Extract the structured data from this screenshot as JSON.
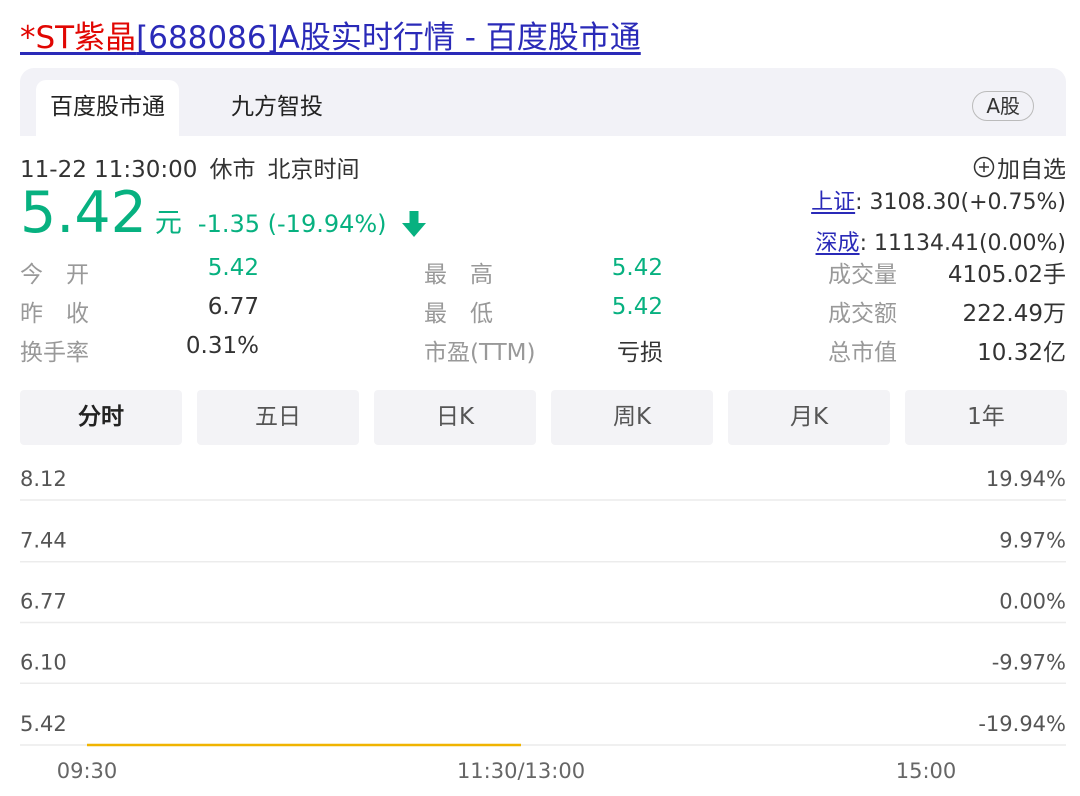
{
  "title": {
    "highlight": "*ST紫晶",
    "rest": "[688086]A股实时行情 - 百度股市通"
  },
  "tabs": [
    "百度股市通",
    "九方智投"
  ],
  "market_badge": "A股",
  "status": {
    "datetime": "11-22 11:30:00",
    "state": "休市",
    "timezone": "北京时间"
  },
  "add_watchlist": "加自选",
  "quote": {
    "price": "5.42",
    "unit": "元",
    "change": "-1.35 (-19.94%)",
    "direction": "down",
    "color": "#07b180"
  },
  "indices": [
    {
      "name": "上证",
      "value": ": 3108.30(+0.75%)"
    },
    {
      "name": "深成",
      "value": ": 11134.41(0.00%)"
    }
  ],
  "stats": {
    "open_label": "今　开",
    "open": "5.42",
    "prev_close_label": "昨　收",
    "prev_close": "6.77",
    "turnover_label": "换手率",
    "turnover": "0.31%",
    "high_label": "最　高",
    "high": "5.42",
    "low_label": "最　低",
    "low": "5.42",
    "pe_label": "市盈(TTM)",
    "pe": "亏损",
    "volume_label": "成交量",
    "volume": "4105.02手",
    "amount_label": "成交额",
    "amount": "222.49万",
    "mktcap_label": "总市值",
    "mktcap": "10.32亿"
  },
  "periods": [
    "分时",
    "五日",
    "日K",
    "周K",
    "月K",
    "1年"
  ],
  "active_period": "分时",
  "chart_data": {
    "type": "line",
    "title": "",
    "y_ticks_left": [
      "8.12",
      "7.44",
      "6.77",
      "6.10",
      "5.42"
    ],
    "y_ticks_right": [
      "19.94%",
      "9.97%",
      "0.00%",
      "-9.97%",
      "-19.94%"
    ],
    "ylim": [
      5.42,
      8.12
    ],
    "x_ticks": [
      "09:30",
      "11:30/13:00",
      "15:00"
    ],
    "session": {
      "start": "09:30",
      "midday": "11:30/13:00",
      "end": "15:00"
    },
    "series": [
      {
        "x": [
          "09:30",
          "11:30"
        ],
        "values": [
          5.42,
          5.42
        ],
        "color": "#f0b400"
      }
    ]
  }
}
